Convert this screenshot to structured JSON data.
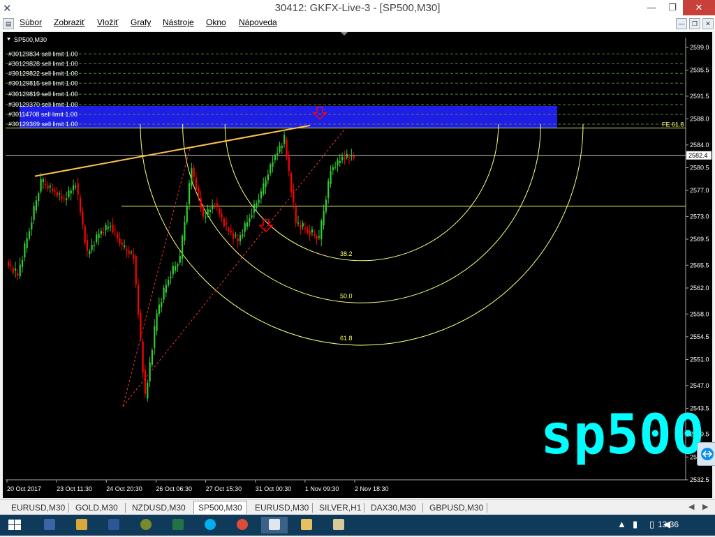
{
  "window": {
    "title": "30412: GKFX-Live-3 - [SP500,M30]",
    "minimize_icon": "minimize-icon",
    "restore_icon": "restore-icon",
    "close_icon": "close-icon"
  },
  "menu": {
    "items": [
      "Súbor",
      "Zobraziť",
      "Vložiť",
      "Grafy",
      "Nástroje",
      "Okno",
      "Nápoveda"
    ]
  },
  "chart": {
    "symbol_label": "SP500,M30",
    "overlay_text": "sp500",
    "current_price_label": "2582.4",
    "fe_label": "FE 61.8",
    "colors": {
      "background": "#000000",
      "bull": "#32cd32",
      "bear": "#ff0000",
      "grid_line": "#ffff80",
      "trendline": "#ffc34d",
      "orders": "#4a8a3c",
      "zone": "#1e1ee6",
      "overlay": "#00ffff",
      "arrow": "#ff0000"
    },
    "orders": [
      "#30129834 sell limit 1.00",
      "#30129828 sell limit 1.00",
      "#30129822 sell limit 1.00",
      "#30129815 sell limit 1.00",
      "#30129819 sell limit 1.00",
      "#30129370 sell limit 1.00",
      "#30114708 sell limit 1.00",
      "#30129369 sell limit 1.00"
    ],
    "fib_arc_labels": [
      "38.2",
      "50.0",
      "61.8"
    ]
  },
  "chart_data": {
    "type": "candlestick",
    "x_tick_labels": [
      "20 Oct 2017",
      "23 Oct 11:30",
      "24 Oct 20:30",
      "26 Oct 06:30",
      "27 Oct 15:30",
      "31 Oct 00:30",
      "1 Nov 09:30",
      "2 Nov 18:30"
    ],
    "y_tick_labels": [
      "2599.0",
      "2595.5",
      "2591.5",
      "2588.0",
      "2584.0",
      "2580.5",
      "2577.0",
      "2573.0",
      "2569.5",
      "2565.5",
      "2562.0",
      "2558.0",
      "2554.5",
      "2551.0",
      "2547.0",
      "2543.5",
      "2539.5",
      "2536.0",
      "2532.5"
    ],
    "ylim": [
      2532.5,
      2600.5
    ],
    "order_levels": [
      2598.0,
      2596.5,
      2595.0,
      2593.5,
      2591.8,
      2590.2,
      2588.7,
      2587.2
    ],
    "zone": {
      "from": 2586.6,
      "to": 2590.0
    },
    "fe_level": 2586.6,
    "current_price": 2582.4,
    "horizontal_line": 2574.6,
    "trendline": [
      [
        2,
        2579.2
      ],
      [
        14,
        2587.2
      ]
    ],
    "fib_arcs": [
      {
        "label": "38.2",
        "center_x": 16.4,
        "center_price": 2587.2,
        "bottom_price": 2566.2
      },
      {
        "label": "50.0",
        "center_x": 16.4,
        "center_price": 2587.2,
        "bottom_price": 2559.7
      },
      {
        "label": "61.8",
        "center_x": 16.4,
        "center_price": 2587.2,
        "bottom_price": 2553.2
      }
    ],
    "series": [
      {
        "name": "close",
        "values": [
          2563.8,
          2571.0,
          2578.3,
          2577.0,
          2575.5,
          2578.1,
          2567.2,
          2570.3,
          2571.7,
          2568.3,
          2566.9,
          2545.0,
          2558.0,
          2563.5,
          2566.5,
          2580.5,
          2572.8,
          2575.0,
          2571.2,
          2569.2,
          2572.9,
          2576.5,
          2581.7,
          2584.8,
          2571.9,
          2570.8,
          2569.5,
          2580.1,
          2582.0,
          2582.4
        ]
      }
    ]
  },
  "tabs": {
    "items": [
      "EURUSD,M30",
      "GOLD,M30",
      "NZDUSD,M30",
      "SP500,M30",
      "EURUSD,M30",
      "SILVER,H1",
      "DAX30,M30",
      "GBPUSD,M30"
    ],
    "active": "SP500,M30"
  },
  "taskbar": {
    "clock": "13:36"
  }
}
